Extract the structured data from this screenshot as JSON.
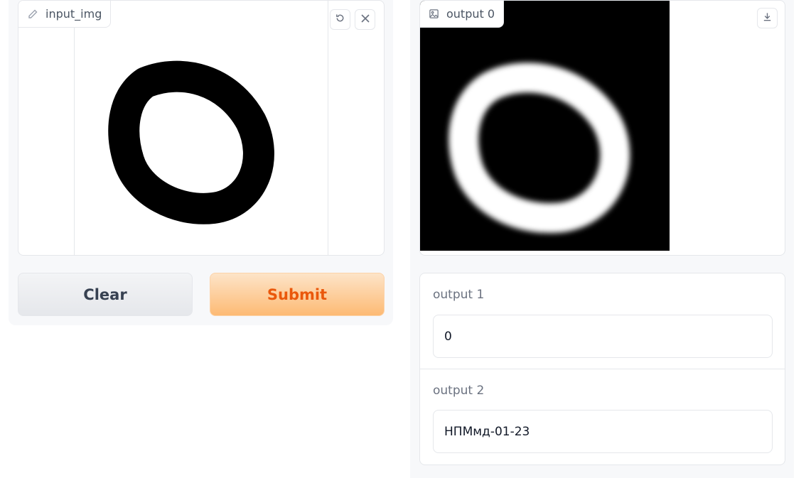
{
  "input_panel": {
    "label": "input_img",
    "label_icon": "pencil-icon",
    "undo_icon": "undo-icon",
    "clear_icon": "close-icon"
  },
  "buttons": {
    "clear_label": "Clear",
    "submit_label": "Submit"
  },
  "outputs": {
    "image_label": "output 0",
    "image_label_icon": "image-icon",
    "download_icon": "download-icon",
    "output1_label": "output 1",
    "output1_value": "0",
    "output2_label": "output 2",
    "output2_value": "НПМмд-01-23"
  },
  "colors": {
    "submit_text": "#ea580c",
    "submit_bg": "#fdba74",
    "border": "#e5e7eb",
    "panel_bg": "#f7f8fa"
  }
}
